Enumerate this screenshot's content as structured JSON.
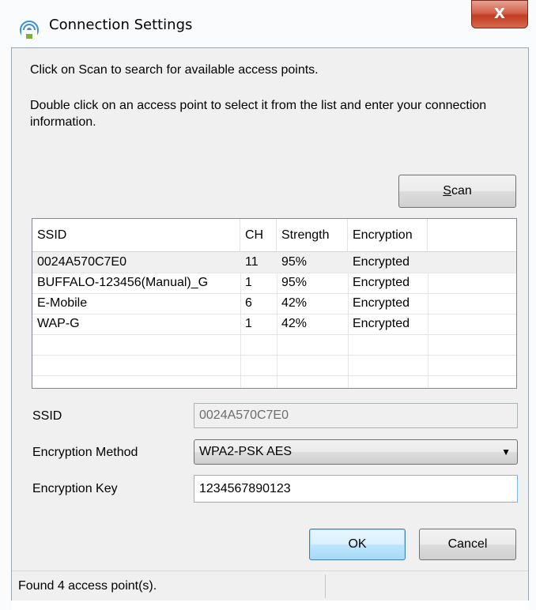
{
  "window": {
    "title": "Connection Settings",
    "close_label": "X",
    "title_icon": "wifi-icon"
  },
  "instructions": {
    "line1": "Click on Scan to search for available access points.",
    "line2": "Double click on an access point to select it from the list and enter your connection information."
  },
  "scan_button": {
    "underline": "S",
    "rest": "can"
  },
  "list": {
    "columns": [
      "SSID",
      "CH",
      "Strength",
      "Encryption"
    ],
    "rows": [
      {
        "ssid": "0024A570C7E0",
        "ch": "11",
        "strength": "95%",
        "encryption": "Encrypted",
        "selected": true
      },
      {
        "ssid": "BUFFALO-123456(Manual)_G",
        "ch": "1",
        "strength": "95%",
        "encryption": "Encrypted",
        "selected": false
      },
      {
        "ssid": "E-Mobile",
        "ch": "6",
        "strength": "42%",
        "encryption": "Encrypted",
        "selected": false
      },
      {
        "ssid": "WAP-G",
        "ch": "1",
        "strength": "42%",
        "encryption": "Encrypted",
        "selected": false
      }
    ]
  },
  "form": {
    "ssid_label": "SSID",
    "ssid_value": "0024A570C7E0",
    "method_label": "Encryption Method",
    "method_value": "WPA2-PSK AES",
    "key_label": "Encryption Key",
    "key_value": "1234567890123"
  },
  "buttons": {
    "ok": "OK",
    "cancel": "Cancel"
  },
  "status": {
    "text": "Found 4 access point(s)."
  },
  "colors": {
    "close_button": "#c23b20",
    "ok_border": "#3c7fb1",
    "client_bg": "#f0f0f0"
  }
}
